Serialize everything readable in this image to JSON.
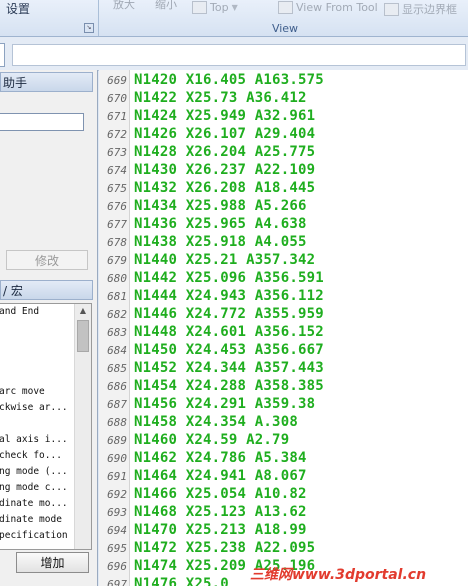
{
  "ribbon": {
    "settings_label": "设置",
    "grey1": "放大",
    "grey2": "缩小",
    "top_label": "Top",
    "view_from_tool_label": "View From Tool",
    "show_boundary_label": "显示边界框",
    "group_label": "View"
  },
  "left_panel": {
    "header": "助手",
    "modify_button": "修改",
    "header2": "/ 宏",
    "list_items": [
      "and End",
      "",
      "",
      "",
      "",
      "arc move",
      "ckwise ar...",
      "",
      "al axis i...",
      "check fo...",
      "ng mode (...",
      "ng mode c...",
      "dinate mo...",
      "dinate mode",
      "pecification"
    ],
    "add_button": "增加"
  },
  "code": {
    "lines": [
      {
        "n": "669",
        "t": "N1420 X16.405 A163.575"
      },
      {
        "n": "670",
        "t": "N1422 X25.73 A36.412"
      },
      {
        "n": "671",
        "t": "N1424 X25.949 A32.961"
      },
      {
        "n": "672",
        "t": "N1426 X26.107 A29.404"
      },
      {
        "n": "673",
        "t": "N1428 X26.204 A25.775"
      },
      {
        "n": "674",
        "t": "N1430 X26.237 A22.109"
      },
      {
        "n": "675",
        "t": "N1432 X26.208 A18.445"
      },
      {
        "n": "676",
        "t": "N1434 X25.988 A5.266"
      },
      {
        "n": "677",
        "t": "N1436 X25.965 A4.638"
      },
      {
        "n": "678",
        "t": "N1438 X25.918 A4.055"
      },
      {
        "n": "679",
        "t": "N1440 X25.21 A357.342"
      },
      {
        "n": "680",
        "t": "N1442 X25.096 A356.591"
      },
      {
        "n": "681",
        "t": "N1444 X24.943 A356.112"
      },
      {
        "n": "682",
        "t": "N1446 X24.772 A355.959"
      },
      {
        "n": "683",
        "t": "N1448 X24.601 A356.152"
      },
      {
        "n": "684",
        "t": "N1450 X24.453 A356.667"
      },
      {
        "n": "685",
        "t": "N1452 X24.344 A357.443"
      },
      {
        "n": "686",
        "t": "N1454 X24.288 A358.385"
      },
      {
        "n": "687",
        "t": "N1456 X24.291 A359.38"
      },
      {
        "n": "688",
        "t": "N1458 X24.354 A.308"
      },
      {
        "n": "689",
        "t": "N1460 X24.59 A2.79"
      },
      {
        "n": "690",
        "t": "N1462 X24.786 A5.384"
      },
      {
        "n": "691",
        "t": "N1464 X24.941 A8.067"
      },
      {
        "n": "692",
        "t": "N1466 X25.054 A10.82"
      },
      {
        "n": "693",
        "t": "N1468 X25.123 A13.62"
      },
      {
        "n": "694",
        "t": "N1470 X25.213 A18.99"
      },
      {
        "n": "695",
        "t": "N1472 X25.238 A22.095"
      },
      {
        "n": "696",
        "t": "N1474 X25.209 A25.196"
      },
      {
        "n": "697",
        "t": "N1476 X25.0"
      }
    ]
  },
  "watermark": "三维网www.3dportal.cn"
}
